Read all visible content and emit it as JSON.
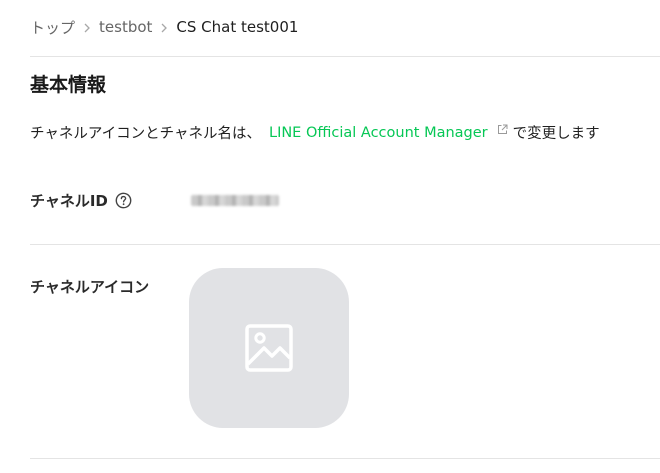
{
  "breadcrumb": {
    "items": [
      "トップ",
      "testbot"
    ],
    "current": "CS Chat test001"
  },
  "section": {
    "title": "基本情報"
  },
  "notice": {
    "prefix": "チャネルアイコンとチャネル名は、",
    "link_text": "LINE Official Account Manager",
    "suffix": "で変更します"
  },
  "fields": {
    "channel_id_label": "チャネルID",
    "channel_icon_label": "チャネルアイコン"
  },
  "icons": {
    "breadcrumb_separator": "chevron-right-icon",
    "external_link": "external-link-icon",
    "help": "help-circle-icon",
    "image_placeholder": "image-icon"
  },
  "colors": {
    "link": "#06c755",
    "placeholder_bg": "#e1e2e5",
    "divider": "#e4e4e4"
  }
}
